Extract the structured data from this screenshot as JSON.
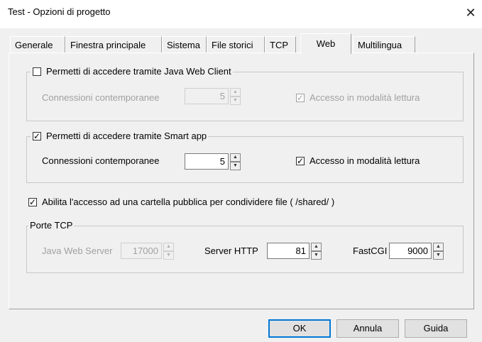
{
  "window": {
    "title": "Test - Opzioni di progetto",
    "close_glyph": "✕"
  },
  "tabs": [
    "Generale",
    "Finestra principale",
    "Sistema",
    "File storici",
    "TCP",
    "Web",
    "Multilingua"
  ],
  "active_tab": "Web",
  "java_group": {
    "label": "Permetti di accedere tramite Java Web Client",
    "checked": false,
    "connections_label": "Connessioni contemporanee",
    "connections_value": "5",
    "readonly_label": "Accesso in modalità lettura",
    "readonly_checked": true
  },
  "smart_group": {
    "label": "Permetti di accedere tramite Smart app",
    "checked": true,
    "connections_label": "Connessioni contemporanee",
    "connections_value": "5",
    "readonly_label": "Accesso in modalità lettura",
    "readonly_checked": true
  },
  "shared_folder": {
    "label": "Abilita l'accesso ad una cartella pubblica per condividere file ( /shared/ )",
    "checked": true
  },
  "ports": {
    "title": "Porte TCP",
    "java_label": "Java Web Server",
    "java_value": "17000",
    "http_label": "Server HTTP",
    "http_value": "81",
    "fastcgi_label": "FastCGI",
    "fastcgi_value": "9000"
  },
  "buttons": {
    "ok": "OK",
    "cancel": "Annula",
    "help": "Guida"
  },
  "check_glyph": "✓"
}
